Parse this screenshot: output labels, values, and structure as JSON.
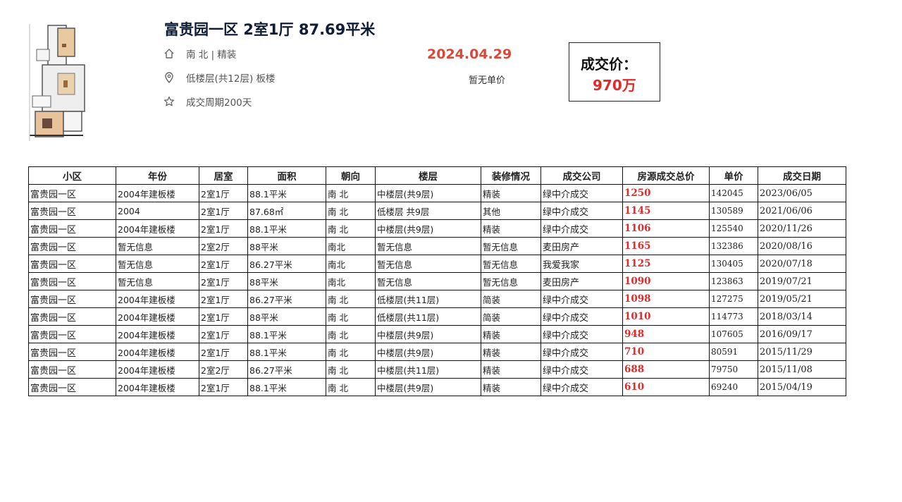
{
  "listing": {
    "title": "富贵园一区 2室1厅 87.69平米",
    "orientation": "南 北 | 精装",
    "floor": "低楼层(共12层) 板楼",
    "cycle": "成交周期200天",
    "deal_date": "2024.04.29",
    "unit_price_note": "暂无单价",
    "price_label": "成交价：",
    "price_value": "970万",
    "icons": [
      "home-icon",
      "location-pin-icon",
      "star-icon"
    ],
    "colors": {
      "date": "#d9493b",
      "price": "#e02a2a",
      "title": "#101d37"
    }
  },
  "table": {
    "headers": [
      "小区",
      "年份",
      "居室",
      "面积",
      "朝向",
      "楼层",
      "装修情况",
      "成交公司",
      "房源成交总价",
      "单价",
      "成交日期"
    ],
    "rows": [
      [
        "富贵园一区",
        "2004年建板楼",
        "2室1厅",
        "88.1平米",
        "南 北",
        "中楼层(共9层)",
        "精装",
        "绿中介成交",
        "1250",
        "142045",
        "2023/06/05"
      ],
      [
        "富贵园一区",
        "2004",
        "2室1厅",
        "87.68㎡",
        "南 北",
        "低楼层 共9层",
        "其他",
        "绿中介成交",
        "1145",
        "130589",
        "2021/06/06"
      ],
      [
        "富贵园一区",
        "2004年建板楼",
        "2室1厅",
        "88.1平米",
        "南 北",
        "中楼层(共9层)",
        "精装",
        "绿中介成交",
        "1106",
        "125540",
        "2020/11/26"
      ],
      [
        "富贵园一区",
        "暂无信息",
        "2室2厅",
        "88平米",
        "南北",
        "暂无信息",
        "暂无信息",
        "麦田房产",
        "1165",
        "132386",
        "2020/08/16"
      ],
      [
        "富贵园一区",
        "暂无信息",
        "2室1厅",
        "86.27平米",
        "南北",
        "暂无信息",
        "暂无信息",
        "我爱我家",
        "1125",
        "130405",
        "2020/07/18"
      ],
      [
        "富贵园一区",
        "暂无信息",
        "2室1厅",
        "88平米",
        "南北",
        "暂无信息",
        "暂无信息",
        "麦田房产",
        "1090",
        "123863",
        "2019/07/21"
      ],
      [
        "富贵园一区",
        "2004年建板楼",
        "2室1厅",
        "86.27平米",
        "南 北",
        "低楼层(共11层)",
        "简装",
        "绿中介成交",
        "1098",
        "127275",
        "2019/05/21"
      ],
      [
        "富贵园一区",
        "2004年建板楼",
        "2室1厅",
        "88平米",
        "南 北",
        "低楼层(共11层)",
        "简装",
        "绿中介成交",
        "1010",
        "114773",
        "2018/03/14"
      ],
      [
        "富贵园一区",
        "2004年建板楼",
        "2室1厅",
        "88.1平米",
        "南 北",
        "中楼层(共9层)",
        "精装",
        "绿中介成交",
        "948",
        "107605",
        "2016/09/17"
      ],
      [
        "富贵园一区",
        "2004年建板楼",
        "2室1厅",
        "88.1平米",
        "南 北",
        "中楼层(共9层)",
        "精装",
        "绿中介成交",
        "710",
        "80591",
        "2015/11/29"
      ],
      [
        "富贵园一区",
        "2004年建板楼",
        "2室2厅",
        "86.27平米",
        "南 北",
        "中楼层(共11层)",
        "精装",
        "绿中介成交",
        "688",
        "79750",
        "2015/11/08"
      ],
      [
        "富贵园一区",
        "2004年建板楼",
        "2室1厅",
        "88.1平米",
        "南 北",
        "中楼层(共9层)",
        "精装",
        "绿中介成交",
        "610",
        "69240",
        "2015/04/19"
      ]
    ]
  }
}
